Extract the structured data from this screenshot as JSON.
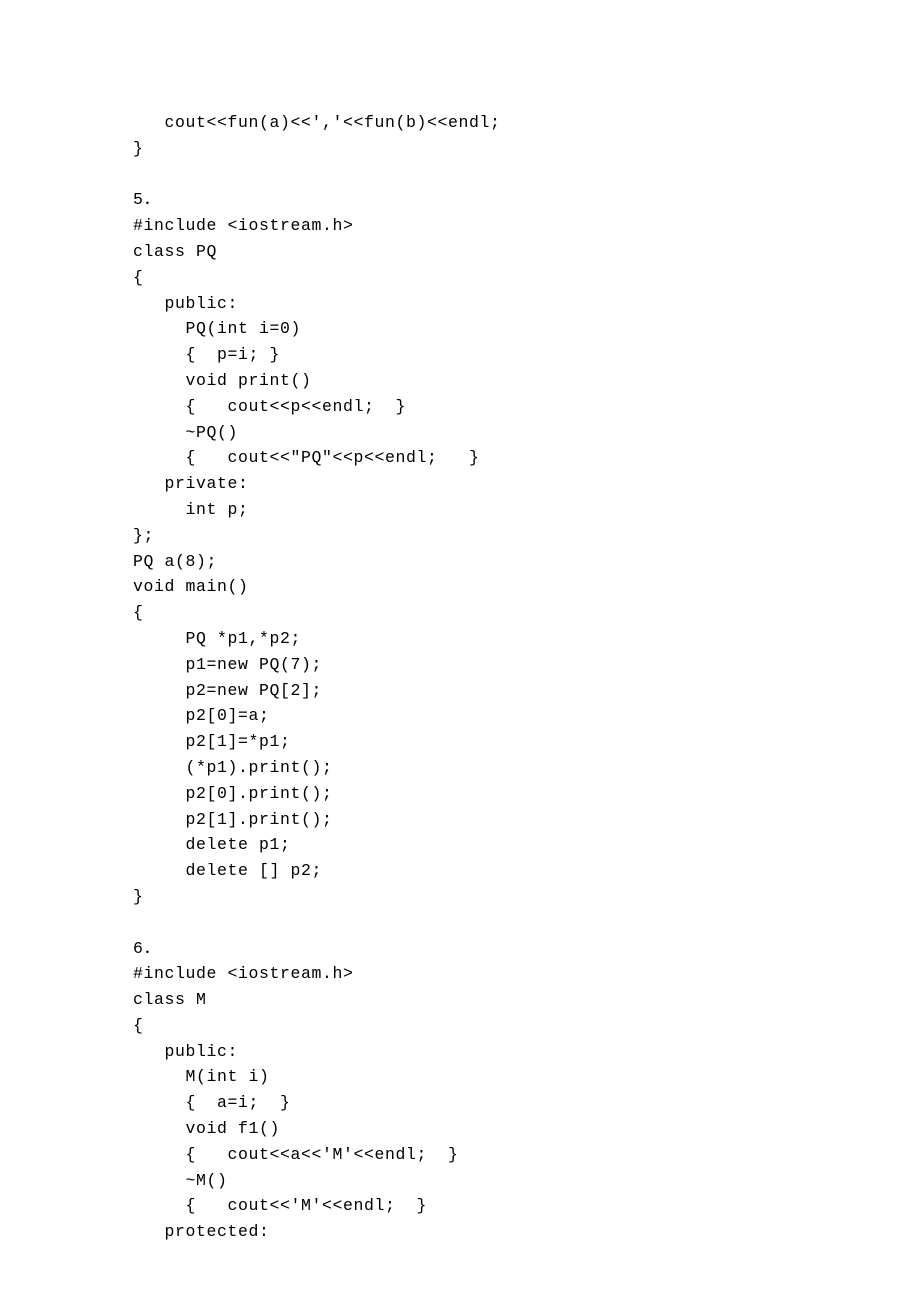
{
  "lines": [
    "   cout<<fun(a)<<','<<fun(b)<<endl;",
    "}",
    "",
    "5．",
    "#include <iostream.h>",
    "class PQ",
    "{",
    "   public:",
    "     PQ(int i=0)",
    "     {  p=i; }",
    "     void print()",
    "     {   cout<<p<<endl;  }",
    "     ~PQ()",
    "     {   cout<<\"PQ\"<<p<<endl;   }",
    "   private:",
    "     int p;",
    "};",
    "PQ a(8);",
    "void main()",
    "{",
    "     PQ *p1,*p2;",
    "     p1=new PQ(7);",
    "     p2=new PQ[2];",
    "     p2[0]=a;",
    "     p2[1]=*p1;",
    "     (*p1).print();",
    "     p2[0].print();",
    "     p2[1].print();",
    "     delete p1;",
    "     delete [] p2;",
    "}",
    "",
    "6．",
    "#include <iostream.h>",
    "class M",
    "{",
    "   public:",
    "     M(int i)",
    "     {  a=i;  }",
    "     void f1()",
    "     {   cout<<a<<'M'<<endl;  }",
    "     ~M()",
    "     {   cout<<'M'<<endl;  }",
    "   protected:"
  ]
}
